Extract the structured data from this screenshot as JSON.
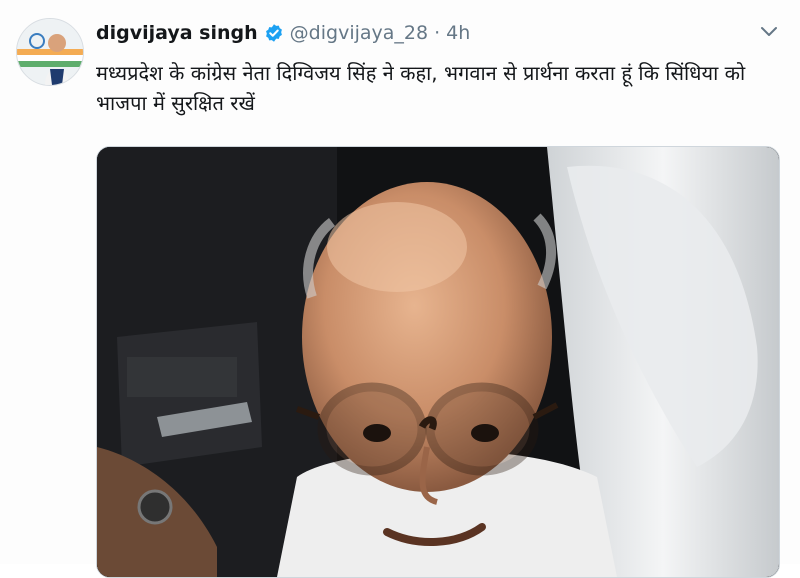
{
  "tweet": {
    "author": {
      "name": "digvijaya singh",
      "handle": "@digvijaya_28",
      "verified": true,
      "avatar_icon": "profile-photo"
    },
    "separator": "·",
    "timestamp": "4h",
    "text": "मध्यप्रदेश के कांग्रेस नेता दिग्विजय सिंह ने कहा, भगवान से प्रार्थना करता हूं कि सिंधिया को भाजपा में सुरक्षित रखें",
    "menu_icon": "chevron-down-icon",
    "media": {
      "type": "photo",
      "icon": "man-with-glasses-photo"
    }
  },
  "colors": {
    "verified_blue": "#1da1f2",
    "secondary_text": "#657786",
    "primary_text": "#14171a"
  }
}
